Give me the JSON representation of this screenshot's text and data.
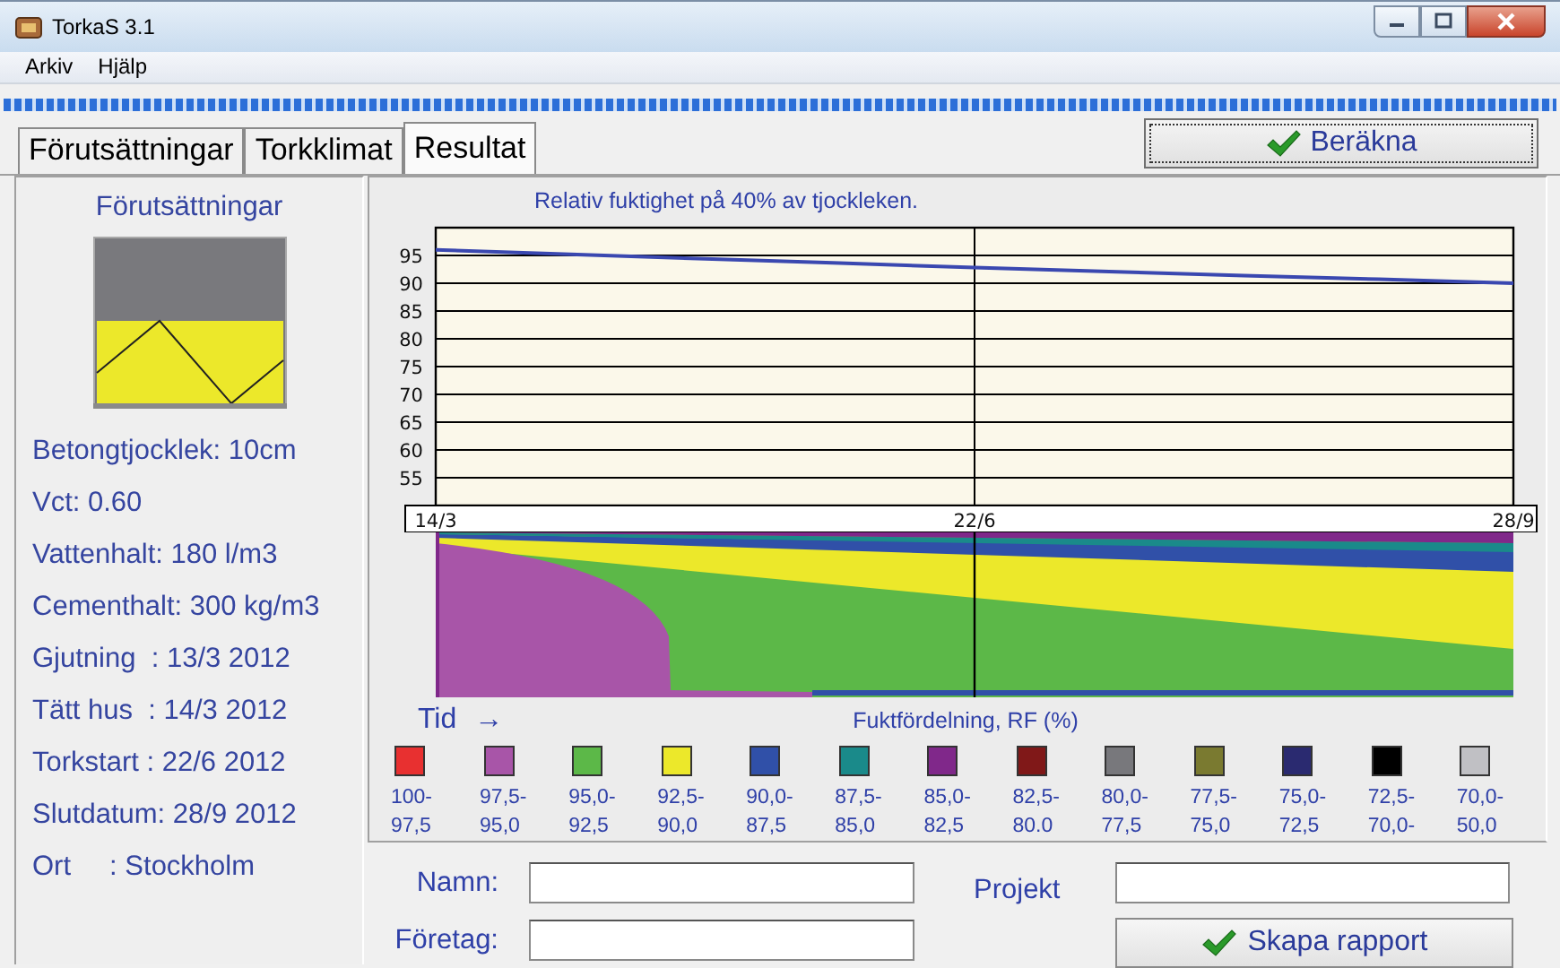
{
  "window": {
    "title": "TorkaS 3.1"
  },
  "menu": [
    "Arkiv",
    "Hjälp"
  ],
  "progress": {
    "level": 1
  },
  "tabs": [
    {
      "label": "Förutsättningar",
      "selected": false
    },
    {
      "label": "Torkklimat",
      "selected": false
    },
    {
      "label": "Resultat",
      "selected": true
    }
  ],
  "calculate_button": "Beräkna",
  "sidebar": {
    "title": "Förutsättningar",
    "items": [
      "Betongtjocklek: 10cm",
      "Vct: 0.60",
      "Vattenhalt: 180 l/m3",
      "Cementhalt: 300 kg/m3",
      "Gjutning  : 13/3 2012",
      "Tätt hus  : 14/3 2012",
      "Torkstart : 22/6 2012",
      "Slutdatum: 28/9 2012",
      "Ort     : Stockholm"
    ]
  },
  "result": {
    "chart_data": {
      "type": "line",
      "title": "Relativ fuktighet på 40% av tjockleken.",
      "categories": [
        "14/3",
        null,
        null,
        null,
        "22/6",
        null,
        null,
        null,
        "28/9"
      ],
      "values": [
        96.0,
        95.2,
        94.4,
        93.6,
        92.8,
        92.1,
        91.4,
        90.7,
        90.0
      ],
      "ylim": [
        50,
        100
      ],
      "grid": true,
      "yticks": [
        55,
        60,
        65,
        70,
        75,
        80,
        85,
        90,
        95
      ]
    },
    "time_label": "Tid",
    "time_arrow": "→",
    "distribution_title": "Fuktfördelning, RF (%)",
    "legend": [
      {
        "color": "#e83030",
        "from": "100-",
        "to": "97,5"
      },
      {
        "color": "#a855a8",
        "from": "97,5-",
        "to": "95,0"
      },
      {
        "color": "#5cb848",
        "from": "95,0-",
        "to": "92,5"
      },
      {
        "color": "#ece82a",
        "from": "92,5-",
        "to": "90,0"
      },
      {
        "color": "#3050a8",
        "from": "90,0-",
        "to": "87,5"
      },
      {
        "color": "#1a8a8a",
        "from": "87,5-",
        "to": "85,0"
      },
      {
        "color": "#80288a",
        "from": "85,0-",
        "to": "82,5"
      },
      {
        "color": "#801818",
        "from": "82,5-",
        "to": "80.0"
      },
      {
        "color": "#78787c",
        "from": "80,0-",
        "to": "77,5"
      },
      {
        "color": "#7a7a30",
        "from": "77,5-",
        "to": "75,0"
      },
      {
        "color": "#2a2a70",
        "from": "75,0-",
        "to": "72,5"
      },
      {
        "color": "#000000",
        "from": "72,5-",
        "to": "70,0-"
      },
      {
        "color": "#c0c0c4",
        "from": "70,0-",
        "to": "50,0"
      }
    ]
  },
  "form": {
    "name_label": "Namn:",
    "company_label": "Företag:",
    "project_label": "Projekt",
    "report_button": "Skapa rapport"
  }
}
